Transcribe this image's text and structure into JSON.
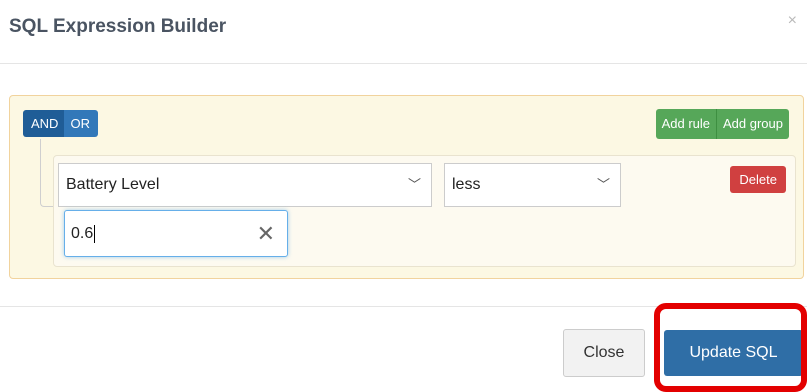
{
  "dialog": {
    "title": "SQL Expression Builder",
    "close_glyph": "×"
  },
  "group": {
    "conjunctions": [
      "AND",
      "OR"
    ],
    "add_rule_label": "Add rule",
    "add_group_label": "Add group"
  },
  "rule": {
    "field_value": "Battery Level",
    "operator_value": "less",
    "input_value": "0.6",
    "delete_label": "Delete",
    "chevron": "﹀",
    "clear_glyph": "✕"
  },
  "footer": {
    "close_label": "Close",
    "update_label": "Update SQL"
  },
  "colors": {
    "primary": "#2f6ea6",
    "success": "#56a759",
    "danger": "#d04040",
    "highlight": "#e30000",
    "group_bg": "#fcf8e3"
  }
}
